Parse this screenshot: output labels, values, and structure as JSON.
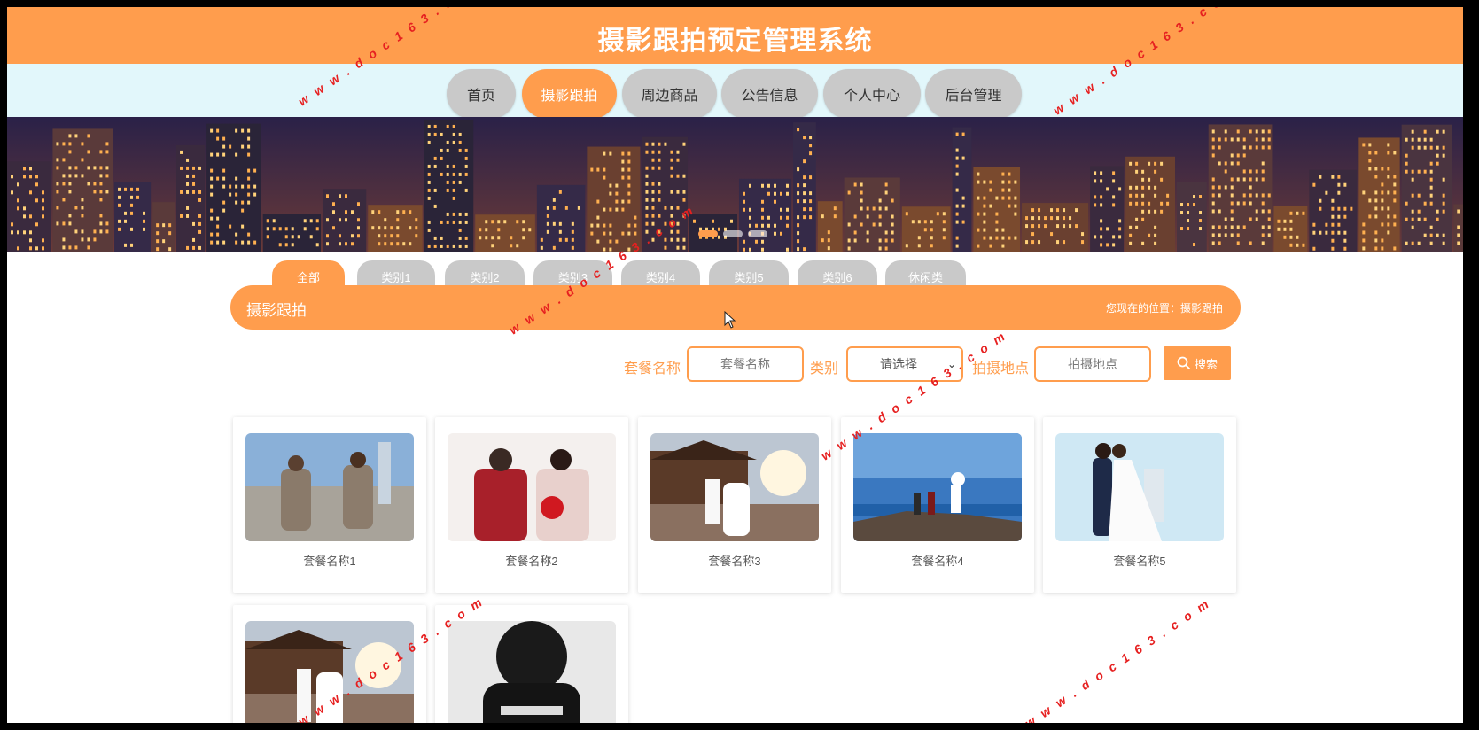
{
  "header": {
    "title": "摄影跟拍预定管理系统"
  },
  "nav": {
    "items": [
      {
        "label": "首页",
        "active": false
      },
      {
        "label": "摄影跟拍",
        "active": true
      },
      {
        "label": "周边商品",
        "active": false
      },
      {
        "label": "公告信息",
        "active": false
      },
      {
        "label": "个人中心",
        "active": false
      },
      {
        "label": "后台管理",
        "active": false
      }
    ]
  },
  "categories": [
    {
      "label": "全部",
      "active": true
    },
    {
      "label": "类别1",
      "active": false
    },
    {
      "label": "类别2",
      "active": false
    },
    {
      "label": "类别3",
      "active": false
    },
    {
      "label": "类别4",
      "active": false
    },
    {
      "label": "类别5",
      "active": false
    },
    {
      "label": "类别6",
      "active": false
    },
    {
      "label": "休闲类",
      "active": false
    }
  ],
  "section": {
    "title": "摄影跟拍",
    "location_prefix": "您现在的位置：",
    "location": "摄影跟拍"
  },
  "search": {
    "name_label": "套餐名称",
    "name_placeholder": "套餐名称",
    "category_label": "类别",
    "category_value": "请选择",
    "location_label": "拍摄地点",
    "location_placeholder": "拍摄地点",
    "button_label": "搜索"
  },
  "products": [
    {
      "name": "套餐名称1"
    },
    {
      "name": "套餐名称2"
    },
    {
      "name": "套餐名称3"
    },
    {
      "name": "套餐名称4"
    },
    {
      "name": "套餐名称5"
    },
    {
      "name": ""
    },
    {
      "name": ""
    }
  ],
  "watermark": {
    "text": "w w w . d o c 1 6 3 . c o m"
  },
  "colors": {
    "accent": "#ff9d4d",
    "nav_bg": "#e2f7fb",
    "inactive": "#c9c9c9"
  }
}
